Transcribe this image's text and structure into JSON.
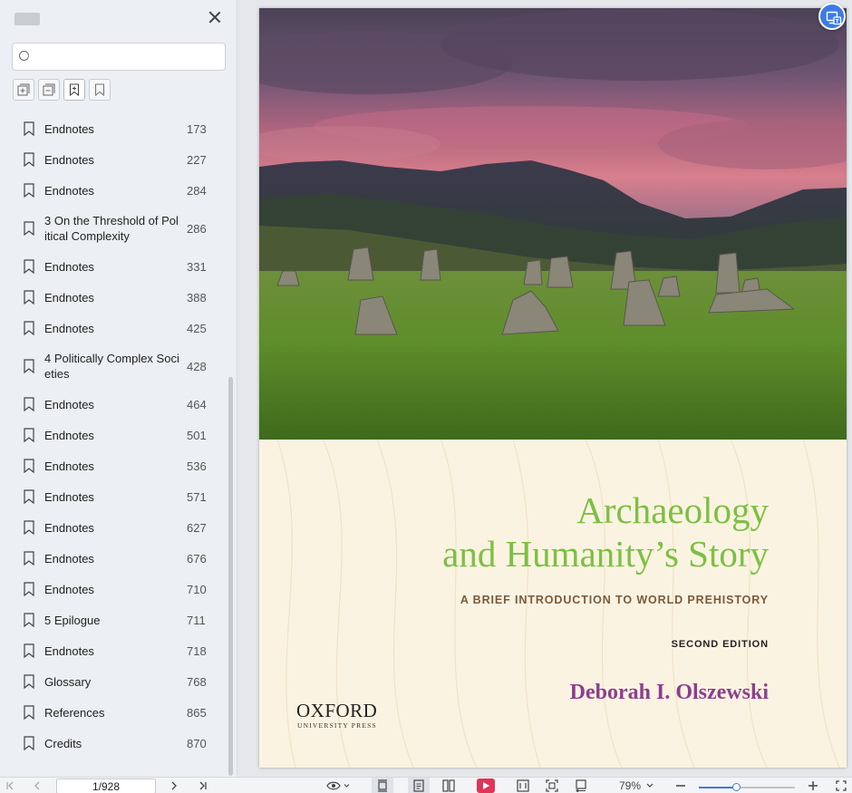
{
  "sidebar": {
    "search": {
      "value": "",
      "placeholder": ""
    },
    "tools": [
      {
        "icon": "expand-all-icon"
      },
      {
        "icon": "collapse-all-icon"
      },
      {
        "icon": "add-bookmark-icon"
      },
      {
        "icon": "bookmark-icon"
      }
    ],
    "bookmarks": [
      {
        "label": "Endnotes",
        "page": "173"
      },
      {
        "label": "Endnotes",
        "page": "227"
      },
      {
        "label": "Endnotes",
        "page": "284"
      },
      {
        "label": "3 On the Threshold of Political Complexity",
        "page": "286"
      },
      {
        "label": "Endnotes",
        "page": "331"
      },
      {
        "label": "Endnotes",
        "page": "388"
      },
      {
        "label": "Endnotes",
        "page": "425"
      },
      {
        "label": "4 Politically Complex Societies",
        "page": "428"
      },
      {
        "label": "Endnotes",
        "page": "464"
      },
      {
        "label": "Endnotes",
        "page": "501"
      },
      {
        "label": "Endnotes",
        "page": "536"
      },
      {
        "label": "Endnotes",
        "page": "571"
      },
      {
        "label": "Endnotes",
        "page": "627"
      },
      {
        "label": "Endnotes",
        "page": "676"
      },
      {
        "label": "Endnotes",
        "page": "710"
      },
      {
        "label": "5 Epilogue",
        "page": "711"
      },
      {
        "label": "Endnotes",
        "page": "718"
      },
      {
        "label": "Glossary",
        "page": "768"
      },
      {
        "label": "References",
        "page": "865"
      },
      {
        "label": "Credits",
        "page": "870"
      }
    ]
  },
  "cover": {
    "title_line1": "Archaeology",
    "title_line2": "and Humanity’s Story",
    "subtitle": "A BRIEF INTRODUCTION TO WORLD PREHISTORY",
    "edition": "SECOND EDITION",
    "author": "Deborah I. Olszewski",
    "publisher": "OXFORD",
    "publisher_sub": "UNIVERSITY PRESS",
    "colors": {
      "title": "#7cc043",
      "author": "#8d3e8f",
      "subtitle": "#7b5a3a",
      "background": "#fbf3e1"
    }
  },
  "statusbar": {
    "page_value": "1/928",
    "zoom": "79%",
    "zoom_fraction": 0.4
  }
}
